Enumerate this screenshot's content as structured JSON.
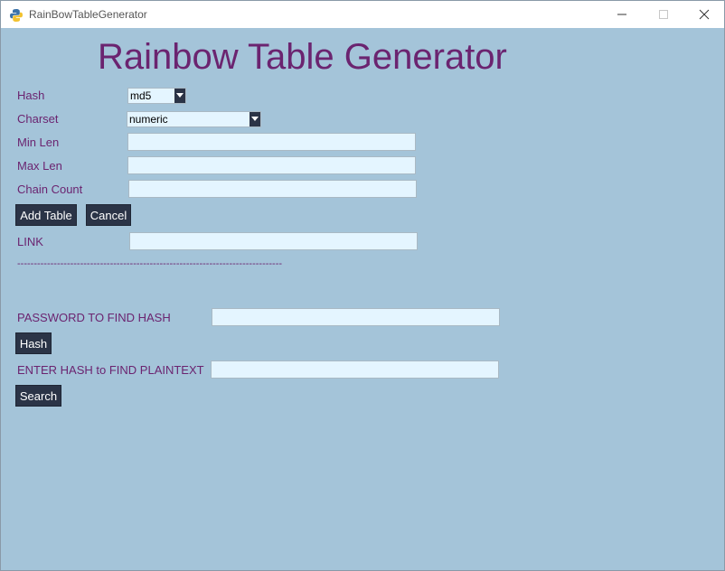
{
  "window": {
    "title": "RainBowTableGenerator",
    "min_icon": "minimize-icon",
    "max_icon": "maximize-icon",
    "close_icon": "close-icon"
  },
  "header": {
    "title": "Rainbow Table Generator"
  },
  "form": {
    "hash_label": "Hash",
    "hash_value": "md5",
    "charset_label": "Charset",
    "charset_value": "numeric",
    "min_len_label": "Min Len",
    "min_len_value": "",
    "max_len_label": "Max Len",
    "max_len_value": "",
    "chain_count_label": "Chain Count",
    "chain_count_value": "",
    "add_table_label": "Add Table",
    "cancel_label": "Cancel",
    "link_label": "LINK",
    "link_value": ""
  },
  "separator": "--------------------------------------------------------------------------------",
  "lookup": {
    "password_label": "PASSWORD TO FIND HASH",
    "password_value": "",
    "hash_button_label": "Hash",
    "hash_input_label": "ENTER HASH to FIND PLAINTEXT",
    "hash_input_value": "",
    "search_button_label": "Search"
  },
  "colors": {
    "background": "#a4c4d9",
    "label": "#6b2470",
    "button": "#2b3447",
    "entry": "#e4f5ff"
  }
}
